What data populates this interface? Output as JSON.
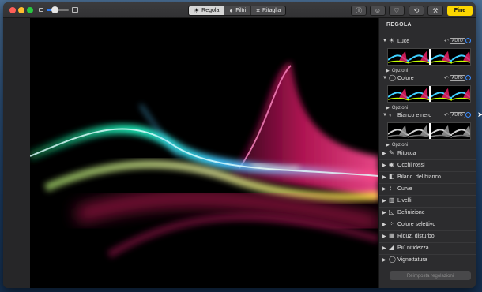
{
  "toolbar": {
    "tabs": [
      {
        "label": "Regola",
        "icon": "adjust-icon",
        "glyph": "☀",
        "active": true
      },
      {
        "label": "Filtri",
        "icon": "filters-icon",
        "glyph": "◐",
        "active": false
      },
      {
        "label": "Ritaglia",
        "icon": "crop-icon",
        "glyph": "⌗",
        "active": false
      }
    ],
    "zoom_level": 0.35,
    "buttons": [
      {
        "name": "info-button",
        "icon": "info-icon",
        "glyph": "ⓘ"
      },
      {
        "name": "smiley-button",
        "icon": "smiley-icon",
        "glyph": "☺"
      },
      {
        "name": "favorite-button",
        "icon": "heart-icon",
        "glyph": "♡"
      },
      {
        "name": "rotate-button",
        "icon": "rotate-icon",
        "glyph": "⟲"
      },
      {
        "name": "enhance-button",
        "icon": "magic-wand-icon",
        "glyph": "⚒"
      }
    ],
    "done_label": "Fine",
    "done_color": "#fcd600"
  },
  "sidebar": {
    "title": "REGOLA",
    "expanded_sections": [
      {
        "label": "Luce",
        "icon": "sun-icon",
        "glyph": "☀",
        "auto": "AUTO",
        "options": "Opzioni",
        "style": "color"
      },
      {
        "label": "Colore",
        "icon": "color-circle-icon",
        "glyph": "◯",
        "auto": "AUTO",
        "options": "Opzioni",
        "style": "color"
      },
      {
        "label": "Bianco e nero",
        "icon": "half-circle-icon",
        "glyph": "◐",
        "auto": "AUTO",
        "options": "Opzioni",
        "style": "mono"
      }
    ],
    "items": [
      {
        "label": "Ritocca",
        "icon": "bandage-icon",
        "glyph": "✎"
      },
      {
        "label": "Occhi rossi",
        "icon": "eye-icon",
        "glyph": "◉"
      },
      {
        "label": "Bilanc. del bianco",
        "icon": "white-balance-icon",
        "glyph": "◧"
      },
      {
        "label": "Curve",
        "icon": "curves-icon",
        "glyph": "⌇"
      },
      {
        "label": "Livelli",
        "icon": "levels-icon",
        "glyph": "▥"
      },
      {
        "label": "Definizione",
        "icon": "triangle-icon",
        "glyph": "◺"
      },
      {
        "label": "Colore selettivo",
        "icon": "dots-icon",
        "glyph": "⁘"
      },
      {
        "label": "Riduz. disturbo",
        "icon": "noise-icon",
        "glyph": "▦"
      },
      {
        "label": "Più nitidezza",
        "icon": "sharpen-icon",
        "glyph": "◢"
      },
      {
        "label": "Vignettatura",
        "icon": "vignette-icon",
        "glyph": "◯"
      }
    ],
    "reset_label": "Reimposta regolazioni"
  },
  "colors": {
    "accent": "#2f7df6",
    "panel": "#2c2c2e",
    "photo_bg": "#000000"
  }
}
